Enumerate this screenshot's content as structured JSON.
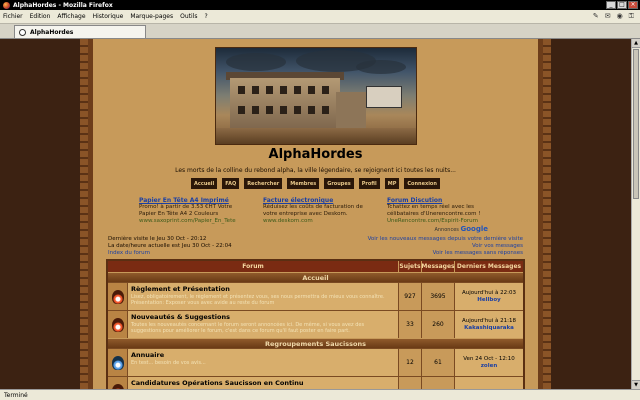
{
  "window": {
    "title": "AlphaHordes - Mozilla Firefox",
    "buttons": [
      "_",
      "□",
      "×"
    ]
  },
  "menubar": {
    "items": [
      "Fichier",
      "Edition",
      "Affichage",
      "Historique",
      "Marque-pages",
      "Outils",
      "?"
    ]
  },
  "tab": {
    "label": "AlphaHordes"
  },
  "status": {
    "text": "Terminé"
  },
  "page": {
    "site_title": "AlphaHordes",
    "description": "Les morts de la colline du rebond alpha, la ville légendaire, se rejoignent ici toutes les nuits...",
    "nav": [
      "Accueil",
      "FAQ",
      "Rechercher",
      "Membres",
      "Groupes",
      "Profil",
      "MP",
      "Connexion"
    ],
    "ads": [
      {
        "title": "Papier En Tête A4 Imprimé",
        "text": "Promo! à partir de 3.53 €HT Votre Papier En Tête A4 2 Couleurs",
        "url": "www.saxoprint.com/Papier_En_Tete"
      },
      {
        "title": "Facture électronique",
        "text": "Réduisez les coûts de facturation de votre entreprise avec Deskom.",
        "url": "www.deskom.com"
      },
      {
        "title": "Forum Discution",
        "text": "Tchattez en temps réel avec les célibataires d'Unerencontre.com !",
        "url": "UneRencontre.com/Espirit-Forum"
      }
    ],
    "google_label": "Annonces",
    "google_brand": "Google",
    "visit_left": [
      "Dernière visite le Jeu 30 Oct - 20:12",
      "La date/heure actuelle est Jeu 30 Oct - 22:04",
      "Index du forum"
    ],
    "visit_right": [
      "Voir les nouveaux messages depuis votre dernière visite",
      "Voir vos messages",
      "Voir les messages sans réponses"
    ]
  },
  "forum": {
    "headers": {
      "forum": "Forum",
      "sujets": "Sujets",
      "messages": "Messages",
      "derniers": "Derniers Messages"
    },
    "categories": [
      {
        "name": "Accueil",
        "rows": [
          {
            "name": "Règlement et Présentation",
            "desc": "Lisez, obligatoirement, le règlement et présentez vous, ses nous permettra de mieux vous connaître. Présentation: Exposer vous avec avide au reste du forum",
            "sujets": "927",
            "messages": "3695",
            "last_date": "Aujourd'hui à 22:03",
            "last_user": "Hellboy"
          },
          {
            "name": "Nouveautés & Suggestions",
            "desc": "Toutes les nouveautés concernant le forum seront annoncées ici. De même, si vous avez des suggestions pour améliorer le forum, c'est dans ce forum qu'il faut poster en faire part.",
            "sujets": "33",
            "messages": "260",
            "last_date": "Aujourd'hui à 21:18",
            "last_user": "Kakashiquaraka"
          }
        ]
      },
      {
        "name": "Regroupements Saucissons",
        "rows": [
          {
            "name": "Annuaire",
            "desc": "En test... besoin de vos avis...",
            "sujets": "12",
            "messages": "61",
            "last_date": "Ven 24 Oct - 12:10",
            "last_user": "zolen"
          },
          {
            "name": "Candidatures Opérations Saucisson en Continu",
            "desc": "",
            "sujets": "",
            "messages": "",
            "last_date": "",
            "last_user": ""
          }
        ]
      }
    ]
  }
}
